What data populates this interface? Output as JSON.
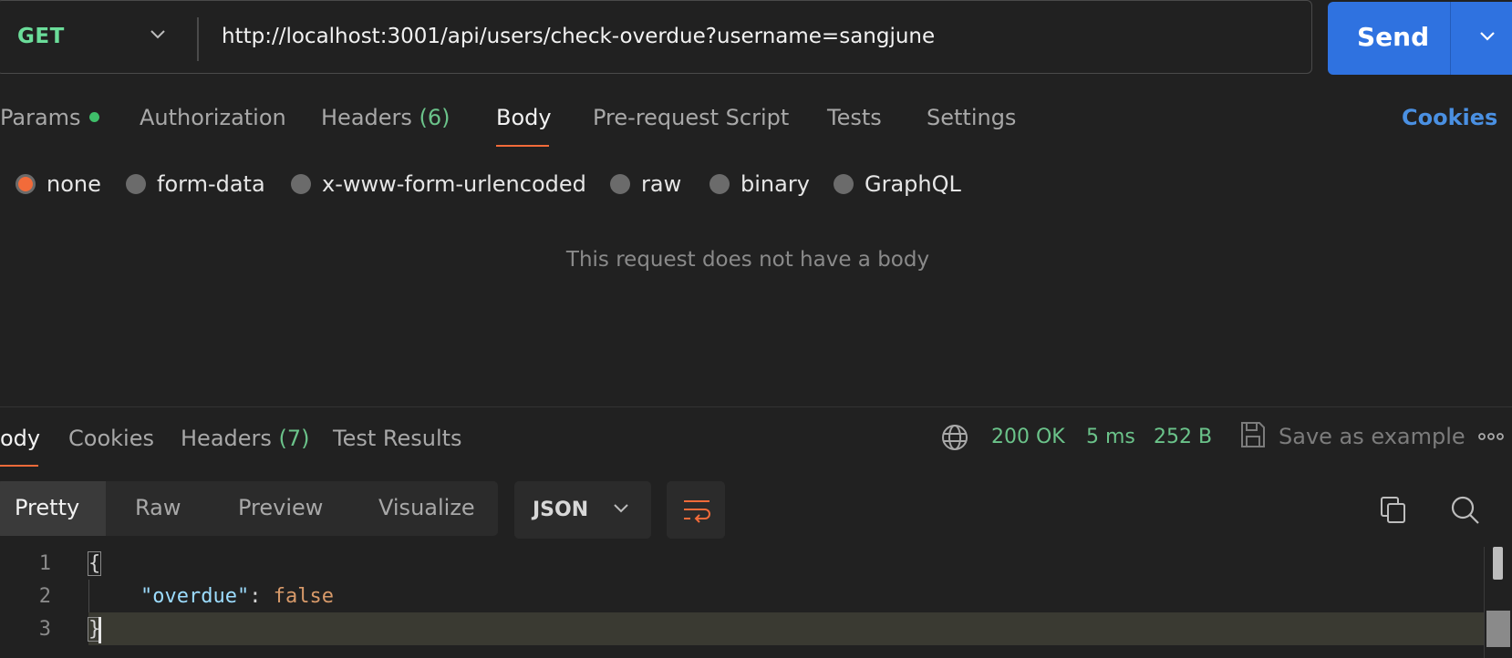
{
  "request": {
    "method": "GET",
    "url": "http://localhost:3001/api/users/check-overdue?username=sangjune",
    "send_label": "Send"
  },
  "request_tabs": {
    "params": "Params",
    "authorization": "Authorization",
    "headers_label": "Headers",
    "headers_count": "(6)",
    "body": "Body",
    "prerequest": "Pre-request Script",
    "tests": "Tests",
    "settings": "Settings",
    "cookies": "Cookies",
    "active": "Body"
  },
  "body_types": {
    "none": "none",
    "form_data": "form-data",
    "urlencoded": "x-www-form-urlencoded",
    "raw": "raw",
    "binary": "binary",
    "graphql": "GraphQL",
    "selected": "none"
  },
  "no_body_message": "This request does not have a body",
  "response_tabs": {
    "body": "ody",
    "cookies": "Cookies",
    "headers_label": "Headers",
    "headers_count": "(7)",
    "test_results": "Test Results",
    "active": "Body"
  },
  "response_status": {
    "status": "200 OK",
    "time": "5 ms",
    "size": "252 B",
    "save_as_example": "Save as example"
  },
  "view_modes": {
    "pretty": "Pretty",
    "raw": "Raw",
    "preview": "Preview",
    "visualize": "Visualize",
    "active": "Pretty"
  },
  "format": "JSON",
  "code": {
    "line_numbers": [
      "1",
      "2",
      "3"
    ],
    "open_brace": "{",
    "key": "\"overdue\"",
    "colon": ": ",
    "value": "false",
    "close_brace": "}"
  },
  "colors": {
    "accent": "#f26b3a",
    "send": "#2f72e0",
    "method": "#6bdd9a",
    "status_ok": "#6bc38a",
    "link": "#4a90e2"
  },
  "icons": {
    "method_dropdown": "chevron-down-icon",
    "send_dropdown": "chevron-down-icon",
    "globe": "globe-icon",
    "save": "save-icon",
    "more": "more-horizontal-icon",
    "wrap": "wrap-lines-icon",
    "copy": "copy-icon",
    "search": "search-icon"
  }
}
